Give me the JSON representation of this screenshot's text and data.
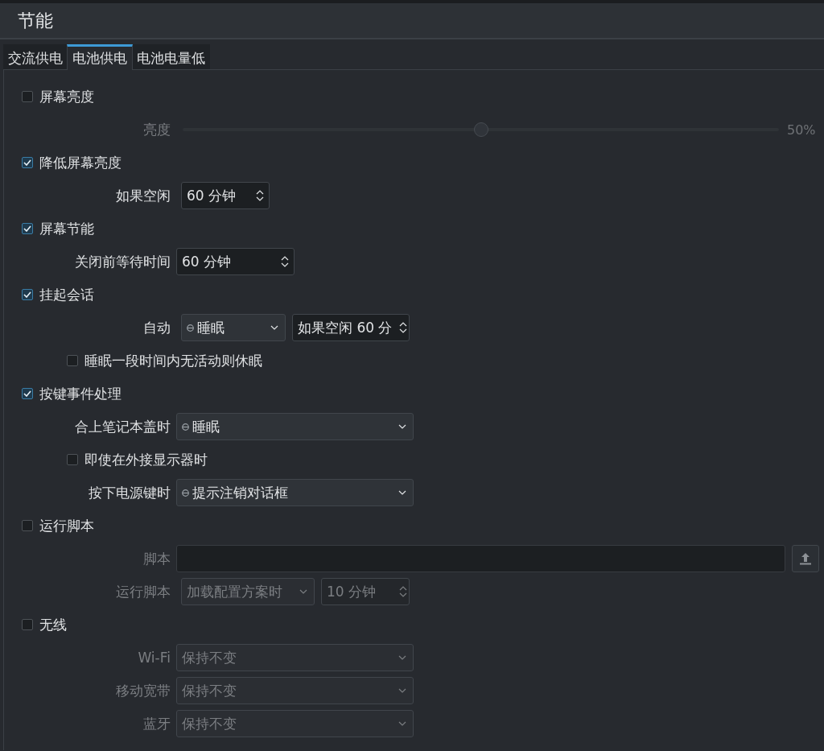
{
  "window": {
    "title": "节能"
  },
  "tabs": [
    {
      "label": "交流供电",
      "selected": false
    },
    {
      "label": "电池供电",
      "selected": true
    },
    {
      "label": "电池电量低",
      "selected": false
    }
  ],
  "sections": [
    {
      "label": "屏幕亮度",
      "checked": false,
      "rows": [
        {
          "kind": "slider",
          "label": "亮度",
          "level": 0.5,
          "reading": "50%"
        }
      ]
    },
    {
      "label": "降低屏幕亮度",
      "checked": true,
      "rows": [
        {
          "kind": "spin",
          "label": "如果空闲",
          "value": "60 分钟"
        }
      ]
    },
    {
      "label": "屏幕节能",
      "checked": true,
      "rows": [
        {
          "kind": "spin",
          "label": "关闭前等待时间",
          "value": "60 分钟"
        }
      ]
    },
    {
      "label": "挂起会话",
      "checked": true,
      "rows": [
        {
          "kind": "combo_spin",
          "label": "自动",
          "combo": "睡眠",
          "spin": "如果空闲 60 分"
        },
        {
          "kind": "checkbox",
          "label": "睡眠一段时间内无活动则休眠",
          "checked": false
        }
      ]
    },
    {
      "label": "按键事件处理",
      "checked": true,
      "rows": [
        {
          "kind": "combo",
          "label": "合上笔记本盖时",
          "value": "睡眠",
          "icon": true
        },
        {
          "kind": "checkbox",
          "label": "即使在外接显示器时",
          "checked": false
        },
        {
          "kind": "combo",
          "label": "按下电源键时",
          "value": "提示注销对话框",
          "icon": true
        }
      ]
    },
    {
      "label": "运行脚本",
      "checked": false,
      "rows": [
        {
          "kind": "file",
          "label": "脚本"
        },
        {
          "kind": "combo_spin",
          "label": "运行脚本",
          "combo": "加载配置方案时",
          "spin": "10 分钟"
        }
      ]
    },
    {
      "label": "无线",
      "checked": false,
      "rows": [
        {
          "kind": "combo",
          "label": "Wi-Fi",
          "value": "保持不变",
          "icon": false
        },
        {
          "kind": "combo",
          "label": "移动宽带",
          "value": "保持不变",
          "icon": false
        },
        {
          "kind": "combo",
          "label": "蓝牙",
          "value": "保持不变",
          "icon": false
        }
      ]
    }
  ]
}
